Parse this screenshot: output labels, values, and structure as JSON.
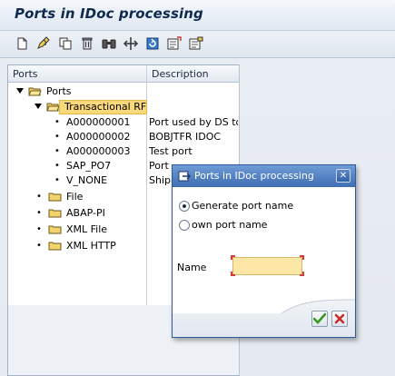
{
  "window": {
    "title": "Ports in IDoc processing"
  },
  "toolbar": {
    "buttons": [
      {
        "name": "create-icon"
      },
      {
        "name": "change-icon"
      },
      {
        "name": "copy-icon"
      },
      {
        "name": "delete-icon"
      },
      {
        "name": "find-icon"
      },
      {
        "name": "navigate-icon"
      },
      {
        "name": "refresh-icon"
      },
      {
        "name": "expand-icon"
      },
      {
        "name": "collapse-icon"
      }
    ]
  },
  "tree": {
    "columns": {
      "name": "Ports",
      "description": "Description"
    },
    "root": {
      "label": "Ports"
    },
    "transactional": {
      "label": "Transactional RF"
    },
    "items": [
      {
        "name": "A000000001",
        "description": "Port used by DS to"
      },
      {
        "name": "A000000002",
        "description": "BOBJTFR IDOC"
      },
      {
        "name": "A000000003",
        "description": "Test port"
      },
      {
        "name": "SAP_PO7",
        "description": "Port ..."
      },
      {
        "name": "V_NONE",
        "description": "Shipm..."
      }
    ],
    "folders": [
      {
        "label": "File"
      },
      {
        "label": "ABAP-PI"
      },
      {
        "label": "XML File"
      },
      {
        "label": "XML HTTP"
      }
    ]
  },
  "dialog": {
    "title": "Ports in IDoc processing",
    "option_generate": "Generate port name",
    "option_own": "own port name",
    "selected_option": "Generate port name",
    "name_label": "Name",
    "name_value": ""
  },
  "colors": {
    "highlight": "#fad97a",
    "dialog_title": "#3e6db2",
    "accent": "#0e2a4f"
  }
}
